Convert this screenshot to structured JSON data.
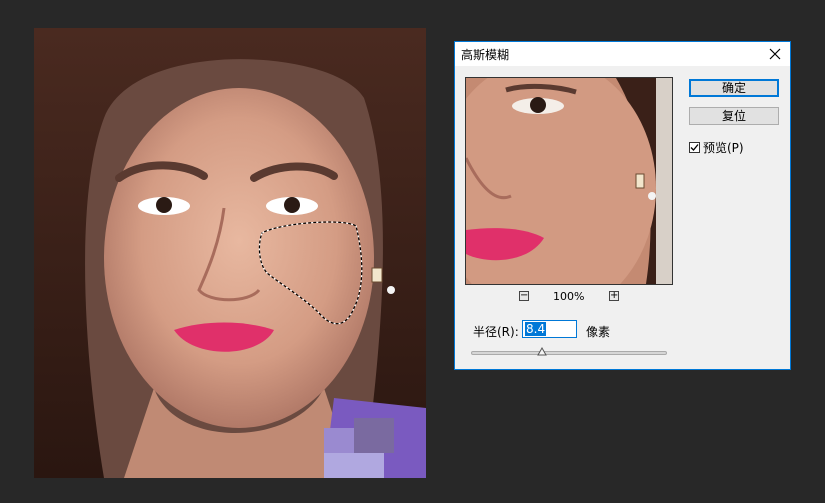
{
  "dialog": {
    "title": "高斯模糊",
    "ok_label": "确定",
    "reset_label": "复位",
    "preview_label": "预览(P)",
    "preview_checked": true,
    "zoom_value": "100%",
    "zoom_out_symbol": "−",
    "zoom_in_symbol": "+",
    "radius_label": "半径(R):",
    "radius_value": "8.4",
    "unit_label": "像素",
    "slider_fraction": 0.36,
    "accent_color": "#0078d7"
  },
  "icons": {
    "close": "close-icon",
    "check": "checkmark-icon"
  }
}
